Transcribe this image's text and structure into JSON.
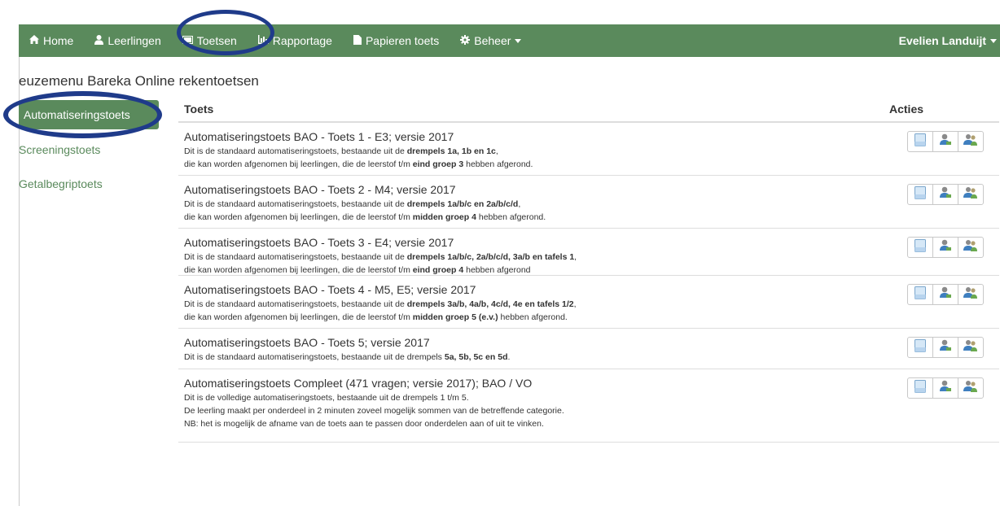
{
  "nav": {
    "items": [
      {
        "label": "Home",
        "icon": "home-icon"
      },
      {
        "label": "Leerlingen",
        "icon": "user-icon"
      },
      {
        "label": "Toetsen",
        "icon": "monitor-icon"
      },
      {
        "label": "Rapportage",
        "icon": "bar-chart-icon"
      },
      {
        "label": "Papieren toets",
        "icon": "document-icon"
      },
      {
        "label": "Beheer",
        "icon": "gear-icon"
      }
    ],
    "user": "Evelien Landuijt"
  },
  "page_title": "euzemenu Bareka Online rekentoetsen",
  "sidebar": {
    "items": [
      {
        "label": "Automatiseringstoets"
      },
      {
        "label": "Screeningstoets"
      },
      {
        "label": "Getalbegriptoets"
      }
    ]
  },
  "table": {
    "col_toets": "Toets",
    "col_acties": "Acties",
    "rows": [
      {
        "title": "Automatiseringstoets BAO - Toets 1 - E3; versie 2017",
        "l1a": "Dit is de standaard automatiseringstoets, bestaande uit de ",
        "l1b": "drempels 1a, 1b en 1c",
        "l1c": ",",
        "l2a": "die kan worden afgenomen bij leerlingen, die de leerstof t/m ",
        "l2b": "eind groep 3",
        "l2c": " hebben afgerond."
      },
      {
        "title": "Automatiseringstoets BAO - Toets 2 - M4; versie 2017",
        "l1a": "Dit is de standaard automatiseringstoets, bestaande uit de ",
        "l1b": "drempels 1a/b/c en 2a/b/c/d",
        "l1c": ",",
        "l2a": "die kan worden afgenomen bij leerlingen, die de leerstof t/m ",
        "l2b": "midden groep 4",
        "l2c": " hebben afgerond."
      },
      {
        "title": "Automatiseringstoets BAO - Toets 3 - E4; versie 2017",
        "l1a": "Dit is de standaard automatiseringstoets, bestaande uit de ",
        "l1b": "drempels 1a/b/c, 2a/b/c/d, 3a/b en tafels 1",
        "l1c": ",",
        "l2a": "die kan worden afgenomen bij leerlingen, die de leerstof t/m ",
        "l2b": "eind groep 4",
        "l2c": " hebben afgerond"
      },
      {
        "title": "Automatiseringstoets BAO - Toets 4 - M5, E5; versie 2017",
        "l1a": "Dit is de standaard automatiseringstoets, bestaande uit de ",
        "l1b": "drempels 3a/b, 4a/b, 4c/d, 4e en tafels 1/2",
        "l1c": ",",
        "l2a": "die kan worden afgenomen bij leerlingen, die de leerstof t/m ",
        "l2b": "midden groep 5 (e.v.)",
        "l2c": " hebben afgerond."
      },
      {
        "title": "Automatiseringstoets BAO - Toets 5; versie 2017",
        "l1a": "Dit is de standaard automatiseringstoets, bestaande uit de drempels ",
        "l1b": "5a, 5b, 5c en 5d",
        "l1c": "."
      },
      {
        "title": "Automatiseringstoets Compleet (471 vragen; versie 2017); BAO / VO",
        "l1a": "Dit is de volledige automatiseringstoets, bestaande uit de drempels 1 t/m 5.",
        "l2a": "De leerling maakt per onderdeel in 2 minuten zoveel mogelijk sommen van de betreffende categorie.",
        "l3a": "NB: het is mogelijk de afname van de toets aan te passen door onderdelen aan of uit te vinken."
      }
    ]
  },
  "colors": {
    "brand": "#5a8a5c",
    "annotation": "#1f3b8a"
  }
}
